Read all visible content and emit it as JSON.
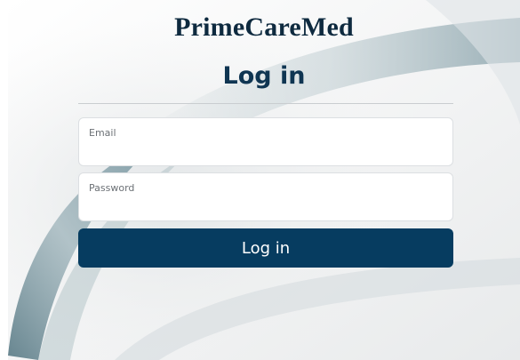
{
  "brand": {
    "name": "PrimeCareMed"
  },
  "form": {
    "heading": "Log in",
    "email": {
      "label": "Email",
      "value": ""
    },
    "password": {
      "label": "Password",
      "value": ""
    },
    "submit_label": "Log in"
  },
  "colors": {
    "primary": "#063c60",
    "brand_text": "#0e2a3f",
    "background": "#f1f2f2",
    "swoosh": "#7d9aa5"
  }
}
